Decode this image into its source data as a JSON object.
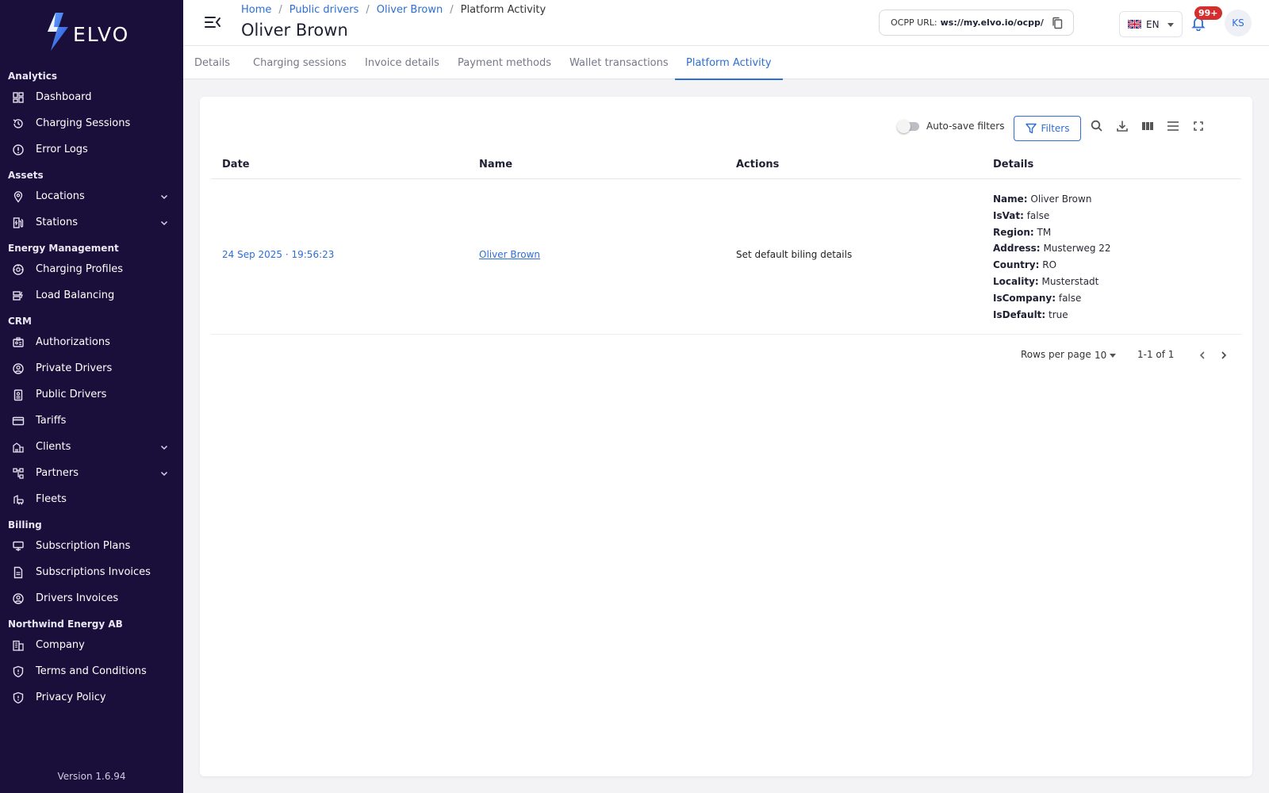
{
  "app": {
    "name": "ELVO",
    "version": "Version 1.6.94"
  },
  "sidebar": {
    "sections": [
      {
        "title": "Analytics",
        "items": [
          {
            "label": "Dashboard",
            "icon": "dashboard-icon"
          },
          {
            "label": "Charging Sessions",
            "icon": "history-icon"
          },
          {
            "label": "Error Logs",
            "icon": "error-icon"
          }
        ]
      },
      {
        "title": "Assets",
        "items": [
          {
            "label": "Locations",
            "icon": "location-pin-icon",
            "expandable": true
          },
          {
            "label": "Stations",
            "icon": "charging-station-icon",
            "expandable": true
          }
        ]
      },
      {
        "title": "Energy Management",
        "items": [
          {
            "label": "Charging Profiles",
            "icon": "gauge-icon"
          },
          {
            "label": "Load Balancing",
            "icon": "load-balancing-icon"
          }
        ]
      },
      {
        "title": "CRM",
        "items": [
          {
            "label": "Authorizations",
            "icon": "id-card-icon"
          },
          {
            "label": "Private Drivers",
            "icon": "user-circle-icon"
          },
          {
            "label": "Public Drivers",
            "icon": "badge-icon"
          },
          {
            "label": "Tariffs",
            "icon": "credit-card-icon"
          },
          {
            "label": "Clients",
            "icon": "buildings-icon",
            "expandable": true
          },
          {
            "label": "Partners",
            "icon": "network-icon",
            "expandable": true
          },
          {
            "label": "Fleets",
            "icon": "fleet-icon"
          }
        ]
      },
      {
        "title": "Billing",
        "items": [
          {
            "label": "Subscription Plans",
            "icon": "plan-icon"
          },
          {
            "label": "Subscriptions Invoices",
            "icon": "document-icon"
          },
          {
            "label": "Drivers Invoices",
            "icon": "user-circle-icon"
          }
        ]
      },
      {
        "title": "Northwind Energy AB",
        "items": [
          {
            "label": "Company",
            "icon": "company-icon"
          },
          {
            "label": "Terms and Conditions",
            "icon": "shield-icon"
          },
          {
            "label": "Privacy Policy",
            "icon": "shield-icon"
          }
        ]
      }
    ]
  },
  "header": {
    "breadcrumb": {
      "home": "Home",
      "public_drivers": "Public drivers",
      "driver": "Oliver Brown",
      "current": "Platform Activity",
      "separator": "/"
    },
    "title": "Oliver Brown",
    "ocpp_label": "OCPP URL:",
    "ocpp_url": "ws://my.elvo.io/ocpp/",
    "language": "EN",
    "notifications_badge": "99+",
    "user_initials": "KS"
  },
  "tabs": [
    {
      "label": "Details",
      "active": false
    },
    {
      "label": "Charging sessions",
      "active": false
    },
    {
      "label": "Invoice details",
      "active": false
    },
    {
      "label": "Payment methods",
      "active": false
    },
    {
      "label": "Wallet transactions",
      "active": false
    },
    {
      "label": "Platform Activity",
      "active": true
    }
  ],
  "toolbar": {
    "autosave_label": "Auto-save filters",
    "autosave_on": false,
    "filters_label": "Filters"
  },
  "table": {
    "columns": {
      "date": "Date",
      "name": "Name",
      "actions": "Actions",
      "details": "Details"
    },
    "rows": [
      {
        "date": "24 Sep 2025 · 19:56:23",
        "name": "Oliver Brown",
        "action": "Set default biling details",
        "details": [
          {
            "key": "Name:",
            "value": "Oliver Brown"
          },
          {
            "key": "IsVat:",
            "value": "false"
          },
          {
            "key": "Region:",
            "value": "TM"
          },
          {
            "key": "Address:",
            "value": "Musterweg 22"
          },
          {
            "key": "Country:",
            "value": "RO"
          },
          {
            "key": "Locality:",
            "value": "Musterstadt"
          },
          {
            "key": "IsCompany:",
            "value": "false"
          },
          {
            "key": "IsDefault:",
            "value": "true"
          }
        ]
      }
    ]
  },
  "pagination": {
    "rows_per_page_label": "Rows per page",
    "rows_per_page": "10",
    "range": "1-1 of 1"
  },
  "colors": {
    "sidebar": "#1a0f3b",
    "accent": "#2d6fd6",
    "badge": "#d32f2f"
  }
}
